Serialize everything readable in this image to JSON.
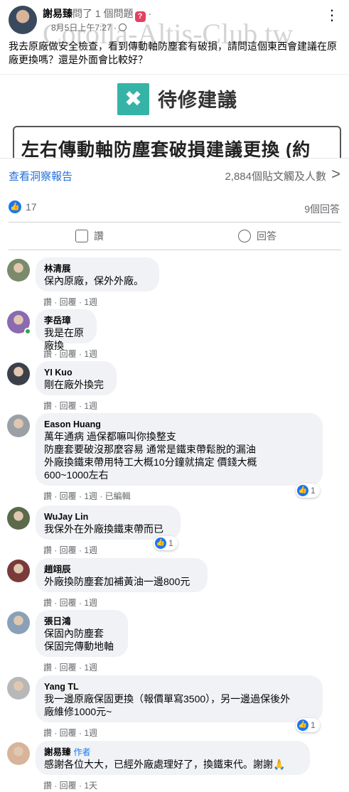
{
  "post": {
    "author": "謝易臻",
    "action": "問了 1 個問題",
    "badge": "?",
    "separator": "·",
    "time": "8月5日上午7:27 ·",
    "watermark": "Corolla-Altis-Club.tw",
    "text": "我去原廠做安全檢查，看到傳動軸防塵套有破損，請問這個東西會建議在原廠更換嗎？還是外面會比較好？"
  },
  "image": {
    "heading": "待修建議",
    "box_text": "左右傳動軸防塵套破損建議更換 (約"
  },
  "insights": {
    "link": "查看洞察報告",
    "reach": "2,884個貼文觸及人數"
  },
  "reactions": {
    "likes": "17",
    "answers": "9個回答"
  },
  "actions": {
    "like": "讚",
    "reply": "回答"
  },
  "comments": [
    {
      "name": "林清展",
      "text": "保內原廠，保外外廠。",
      "meta": "讚 · 回覆 · 1週",
      "reacts": null
    },
    {
      "name": "李岳璋",
      "text": "我是在原廠換",
      "meta": "讚 · 回覆 · 1週",
      "reacts": null
    },
    {
      "name": "YI Kuo",
      "text": "剛在廠外換完",
      "meta": "讚 · 回覆 · 1週",
      "reacts": null
    },
    {
      "name": "Eason Huang",
      "text": "萬年通病 過保都嘛叫你換整支\n防塵套要破沒那麼容易 通常是鐵束帶鬆脫的漏油\n外廠換鐵束帶用特工大概10分鐘就搞定 價錢大概\n600~1000左右",
      "meta": "讚 · 回覆 · 1週 · 已編輯",
      "reacts": "1"
    },
    {
      "name": "WuJay Lin",
      "text": "我保外在外廠換鐵束帶而已",
      "meta": "讚 · 回覆 · 1週",
      "reacts": "1"
    },
    {
      "name": "趙翊辰",
      "text": "外廠換防塵套加補黃油一邊800元",
      "meta": "讚 · 回覆 · 1週",
      "reacts": null
    },
    {
      "name": "張日鴻",
      "text": "保固內防塵套\n保固完傳動地軸",
      "meta": "讚 · 回覆 · 1週",
      "reacts": null
    },
    {
      "name": "Yang TL",
      "text": "我一邊原廠保固更換（報價單寫3500），另一邊過保後外\n廠維修1000元~",
      "meta": "讚 · 回覆 · 1週",
      "reacts": "1"
    },
    {
      "name": "謝易臻",
      "author_tag": "作者",
      "text": "感謝各位大大，已經外廠處理好了，換鐵束代。謝謝🙏",
      "meta": "讚 · 回覆 · 1天",
      "reacts": null
    }
  ]
}
